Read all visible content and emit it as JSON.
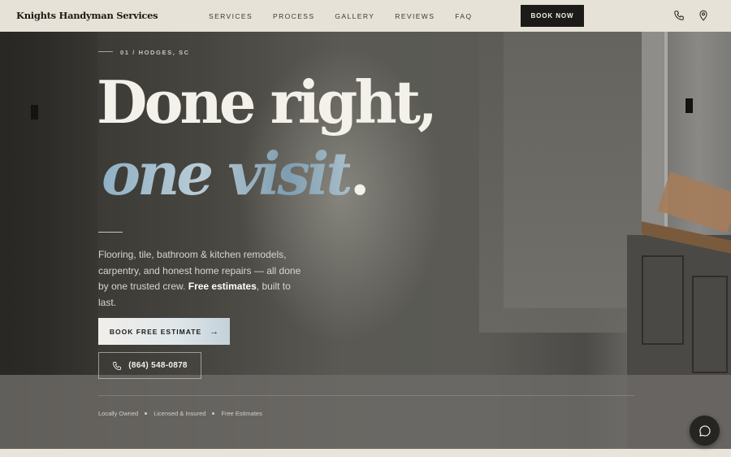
{
  "nav": {
    "brand": "Knights Handyman Services",
    "links": [
      "SERVICES",
      "PROCESS",
      "GALLERY",
      "REVIEWS",
      "FAQ"
    ],
    "cta": "BOOK NOW",
    "icons": [
      "phone-icon",
      "location-pin-icon"
    ]
  },
  "hero": {
    "eyebrow": "01 / HODGES, SC",
    "headline_line1": "Done right,",
    "headline_line2": "one visit",
    "headline_period": ".",
    "lede_part1": "Flooring, tile, bathroom & kitchen remodels, carpentry, and honest home repairs — all done by one trusted crew. ",
    "lede_bold": "Free estimates",
    "lede_part2": ", built to last.",
    "primary_button": "BOOK FREE ESTIMATE",
    "phone_button": "(864) 548-0878",
    "trust": [
      "Locally Owned",
      "Licensed & Insured",
      "Free Estimates"
    ]
  },
  "colors": {
    "nav_bg": "#e7e2d8",
    "cta_bg": "#1d1b18",
    "headline": "#f4f1ea",
    "accent_gradient_start": "#8fb0c4"
  },
  "chat_icon": "chat-bubble-icon"
}
